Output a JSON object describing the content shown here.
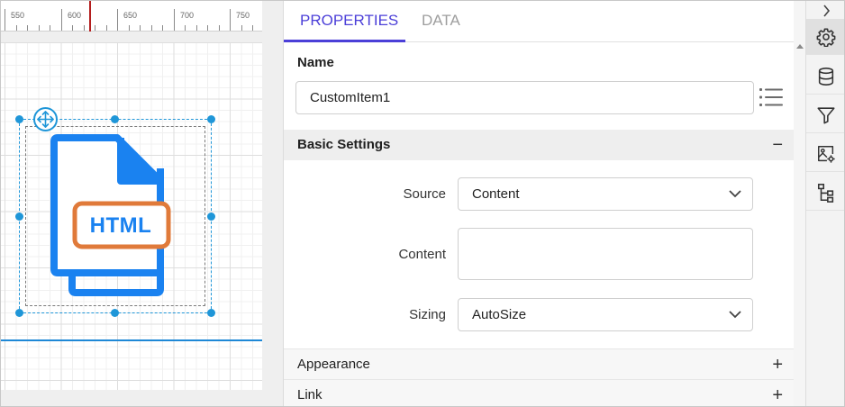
{
  "ruler": {
    "labels": [
      "550",
      "600",
      "650",
      "700",
      "750"
    ]
  },
  "canvas": {
    "item_text": "HTML",
    "colors": {
      "icon_blue": "#1a82f0",
      "badge_orange": "#e07a3a",
      "selection": "#1f96d8",
      "band_line": "#1e88d6",
      "ruler_marker": "#b41e1e"
    }
  },
  "tabs": [
    {
      "label": "PROPERTIES",
      "active": true
    },
    {
      "label": "DATA",
      "active": false
    }
  ],
  "name": {
    "label": "Name",
    "value": "CustomItem1"
  },
  "sections": {
    "basic": {
      "label": "Basic Settings",
      "toggle": "−"
    },
    "appearance": {
      "label": "Appearance",
      "toggle": "+"
    },
    "link": {
      "label": "Link",
      "toggle": "+"
    }
  },
  "basic_settings": {
    "source": {
      "label": "Source",
      "value": "Content"
    },
    "content": {
      "label": "Content",
      "value": ""
    },
    "sizing": {
      "label": "Sizing",
      "value": "AutoSize"
    }
  },
  "toolbar": {
    "icons": [
      "chevron-right-icon",
      "gear-icon",
      "database-icon",
      "filter-icon",
      "image-settings-icon",
      "tree-icon"
    ],
    "active": "gear-icon"
  },
  "theme": {
    "accent": "#4b3fd8"
  }
}
